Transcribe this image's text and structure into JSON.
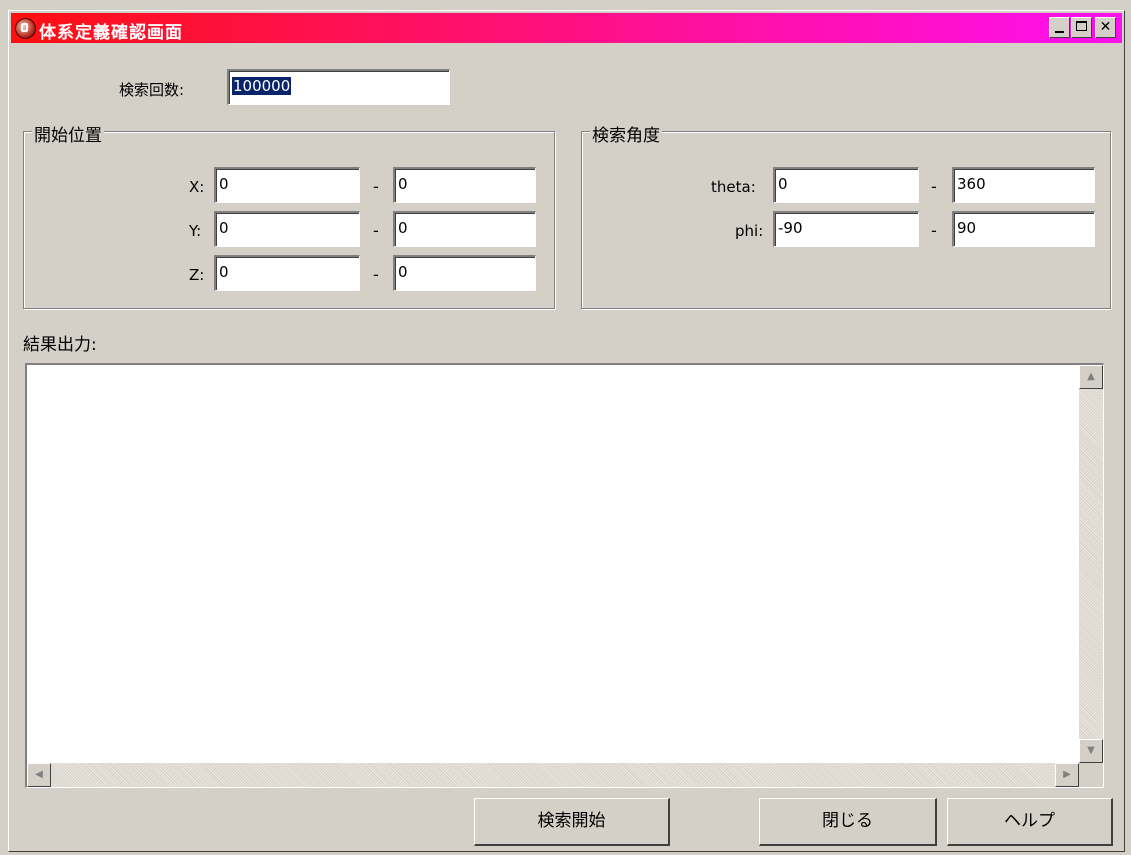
{
  "window": {
    "title": "体系定義確認画面",
    "min_symbol": "_",
    "max_symbol": "□",
    "close_symbol": "✕"
  },
  "search_count": {
    "label": "検索回数:",
    "value": "100000"
  },
  "start_position": {
    "legend": "開始位置",
    "rows": [
      {
        "label": "X:",
        "from": "0",
        "to": "0"
      },
      {
        "label": "Y:",
        "from": "0",
        "to": "0"
      },
      {
        "label": "Z:",
        "from": "0",
        "to": "0"
      }
    ]
  },
  "search_angle": {
    "legend": "検索角度",
    "rows": [
      {
        "label": "theta:",
        "from": "0",
        "to": "360"
      },
      {
        "label": "phi:",
        "from": "-90",
        "to": "90"
      }
    ]
  },
  "range_separator": "-",
  "result": {
    "label": "結果出力:",
    "text": ""
  },
  "scroll": {
    "up": "▲",
    "down": "▼",
    "left": "◀",
    "right": "▶"
  },
  "buttons": {
    "start": "検索開始",
    "close": "閉じる",
    "help": "ヘルプ"
  }
}
